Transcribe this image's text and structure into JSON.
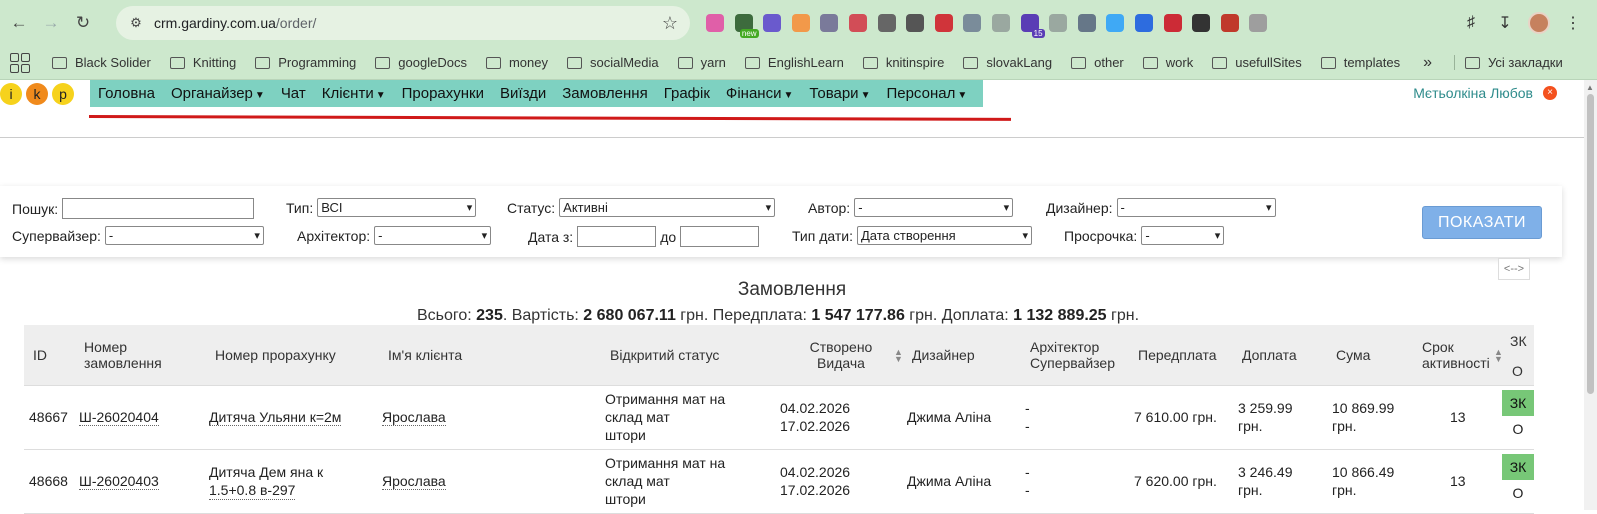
{
  "browser": {
    "url_host": "crm.gardiny.com.ua",
    "url_path": "/order/",
    "extensions": [
      {
        "icon": "pink-gradient-icon",
        "color": "#e05fa8",
        "badge": ""
      },
      {
        "icon": "new-tab-icon",
        "color": "#3d6b3d",
        "badge": "new"
      },
      {
        "icon": "color-wheel-icon",
        "color": "#6a5acd",
        "badge": ""
      },
      {
        "icon": "orange-box-icon",
        "color": "#f2994a",
        "badge": ""
      },
      {
        "icon": "react-icon",
        "color": "#7a7a9a",
        "badge": ""
      },
      {
        "icon": "people-icon",
        "color": "#d24d57",
        "badge": ""
      },
      {
        "icon": "camera-icon",
        "color": "#666666",
        "badge": ""
      },
      {
        "icon": "check-circle-icon",
        "color": "#555555",
        "badge": ""
      },
      {
        "icon": "number-two-icon",
        "color": "#d0343a",
        "badge": ""
      },
      {
        "icon": "dots-icon",
        "color": "#7a8c9a",
        "badge": ""
      },
      {
        "icon": "slash-icon",
        "color": "#9aa8a0",
        "badge": ""
      },
      {
        "icon": "house-icon",
        "color": "#5a3db5",
        "badge": "15"
      },
      {
        "icon": "grid-icon",
        "color": "#9aa8a0",
        "badge": ""
      },
      {
        "icon": "code-icon",
        "color": "#667788",
        "badge": ""
      },
      {
        "icon": "rainbow-ring-icon",
        "color": "#3fa9f5",
        "badge": ""
      },
      {
        "icon": "tag-icon",
        "color": "#2d6cdf",
        "badge": ""
      },
      {
        "icon": "flag-icon",
        "color": "#cc2b36",
        "badge": ""
      },
      {
        "icon": "octocat-icon",
        "color": "#333333",
        "badge": ""
      },
      {
        "icon": "red-square-icon",
        "color": "#c0392b",
        "badge": ""
      },
      {
        "icon": "lightning-icon",
        "color": "#9e9e9e",
        "badge": ""
      }
    ],
    "bookmarks": [
      "Black Solider",
      "Knitting",
      "Programming",
      "googleDocs",
      "money",
      "socialMedia",
      "yarn",
      "EnglishLearn",
      "knitinspire",
      "slovakLang",
      "other",
      "work",
      "usefullSites",
      "templates"
    ],
    "bookmarks_all": "Усі закладки"
  },
  "app": {
    "logo": [
      "i",
      "k",
      "p"
    ],
    "logo_colors": [
      "#f6d21c",
      "#f08a1c",
      "#f6d21c"
    ],
    "menu": [
      {
        "label": "Головна",
        "has_caret": false
      },
      {
        "label": "Органайзер",
        "has_caret": true
      },
      {
        "label": "Чат",
        "has_caret": false
      },
      {
        "label": "Клієнти",
        "has_caret": true
      },
      {
        "label": "Прорахунки",
        "has_caret": false
      },
      {
        "label": "Виїзди",
        "has_caret": false
      },
      {
        "label": "Замовлення",
        "has_caret": false
      },
      {
        "label": "Графік",
        "has_caret": false
      },
      {
        "label": "Фінанси",
        "has_caret": true
      },
      {
        "label": "Товари",
        "has_caret": true
      },
      {
        "label": "Персонал",
        "has_caret": true
      }
    ],
    "user_name": "Мєтьолкіна Любов",
    "logout_symbol": "×"
  },
  "filters": {
    "search_label": "Пошук:",
    "search_value": "",
    "type_label": "Тип:",
    "type_value": "ВСІ",
    "status_label": "Статус:",
    "status_value": "Активні",
    "author_label": "Автор:",
    "author_value": "-",
    "designer_label": "Дизайнер:",
    "designer_value": "-",
    "supervisor_label": "Супервайзер:",
    "supervisor_value": "-",
    "architect_label": "Архітектор:",
    "architect_value": "-",
    "date_from_label": "Дата з:",
    "date_from_value": "",
    "date_to_label": "до",
    "date_to_value": "",
    "date_type_label": "Тип дати:",
    "date_type_value": "Дата створення",
    "overdue_label": "Просрочка:",
    "overdue_value": "-",
    "show_button": "ПОКАЗАТИ",
    "toggle_width": "<-->"
  },
  "orders": {
    "title": "Замовлення",
    "summary": {
      "total_label": "Всього:",
      "total": "235",
      "cost_label": ". Вартість:",
      "cost": "2 680 067.11",
      "prepay_label": " грн. Передплата:",
      "prepay": "1 547 177.86",
      "surcharge_label": " грн. Доплата:",
      "surcharge": "1 132 889.25",
      "tail": " грн."
    },
    "columns": {
      "id": "ID",
      "order_number_1": "Номер",
      "order_number_2": "замовлення",
      "calc_number": "Номер прорахунку",
      "client": "Ім'я клієнта",
      "open_status": "Відкритий статус",
      "created_1": "Створено",
      "created_2": "Видача",
      "designer": "Дизайнер",
      "architect_1": "Архітектор",
      "architect_2": "Супервайзер",
      "prepay": "Передплата",
      "surcharge": "Доплата",
      "sum": "Сума",
      "term_1": "Срок",
      "term_2": "активності",
      "zk_1": "ЗК",
      "zk_2": "О"
    },
    "rows": [
      {
        "id": "48667",
        "order_number": "Ш-26020404",
        "calc_line1": "Дитяча Ульяни к=2м",
        "calc_line2": "",
        "client": "Ярослава",
        "status_line1": "Отримання мат на",
        "status_line2": "склад мат",
        "status_line3": "штори",
        "created": "04.02.2026",
        "issue": "17.02.2026",
        "designer": "Джима Аліна",
        "architect": "-",
        "supervisor": "-",
        "prepay": "7 610.00 грн.",
        "surcharge_1": "3 259.99",
        "surcharge_2": "грн.",
        "sum_1": "10 869.99",
        "sum_2": "грн.",
        "term": "13",
        "zk": "ЗК",
        "o": "О"
      },
      {
        "id": "48668",
        "order_number": "Ш-26020403",
        "calc_line1": "Дитяча Дем яна к",
        "calc_line2": "1.5+0.8 в-297",
        "client": "Ярослава",
        "status_line1": "Отримання мат на",
        "status_line2": "склад мат",
        "status_line3": "штори",
        "created": "04.02.2026",
        "issue": "17.02.2026",
        "designer": "Джима Аліна",
        "architect": "-",
        "supervisor": "-",
        "prepay": "7 620.00 грн.",
        "surcharge_1": "3 246.49",
        "surcharge_2": "грн.",
        "sum_1": "10 866.49",
        "sum_2": "грн.",
        "term": "13",
        "zk": "ЗК",
        "o": "О"
      }
    ]
  }
}
